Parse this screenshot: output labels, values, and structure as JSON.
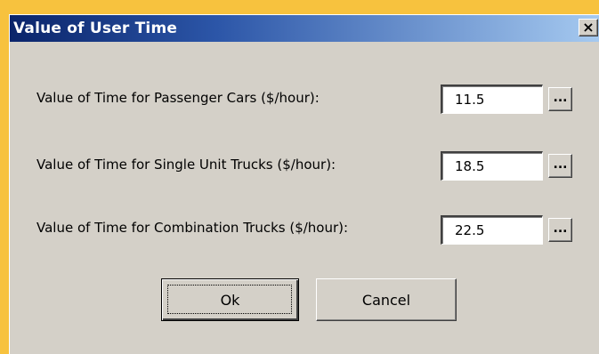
{
  "dialog": {
    "title": "Value of User Time",
    "close_label": "×"
  },
  "fields": [
    {
      "label": "Value of Time for Passenger Cars ($/hour):",
      "value": "11.5",
      "browse_label": "..."
    },
    {
      "label": "Value of Time for Single Unit Trucks ($/hour):",
      "value": "18.5",
      "browse_label": "..."
    },
    {
      "label": "Value of Time for Combination Trucks ($/hour):",
      "value": "22.5",
      "browse_label": "..."
    }
  ],
  "buttons": {
    "ok_label": "Ok",
    "cancel_label": "Cancel"
  },
  "colors": {
    "background": "#f7c23e",
    "titlebar_start": "#0a246a",
    "titlebar_end": "#a6caf0",
    "dialog_face": "#d4d0c8"
  }
}
